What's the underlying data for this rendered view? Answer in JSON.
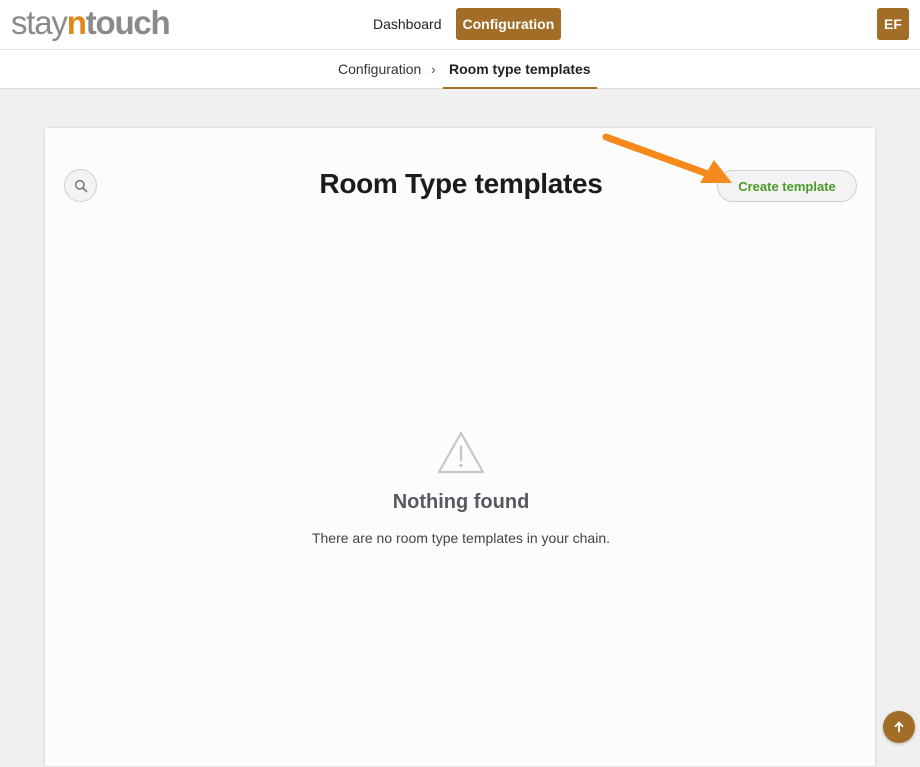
{
  "brand": {
    "part1": "stay",
    "part2": "n",
    "part3": "touch"
  },
  "nav": {
    "dashboard": "Dashboard",
    "configuration": "Configuration"
  },
  "user": {
    "initials": "EF"
  },
  "breadcrumb": {
    "root": "Configuration",
    "separator": "›",
    "current": "Room type templates"
  },
  "page": {
    "title": "Room Type templates",
    "create_label": "Create template"
  },
  "empty_state": {
    "title": "Nothing found",
    "message": "There are no room type templates in your chain."
  },
  "icons": {
    "search": "search-icon",
    "warning": "warning-triangle-icon",
    "scroll_top": "arrow-up-icon",
    "annotation": "annotation-arrow"
  },
  "colors": {
    "accent": "#a26d27",
    "brand_orange": "#e0891a",
    "create_text": "#4a9a2a",
    "annotation_arrow": "#f5891b"
  }
}
